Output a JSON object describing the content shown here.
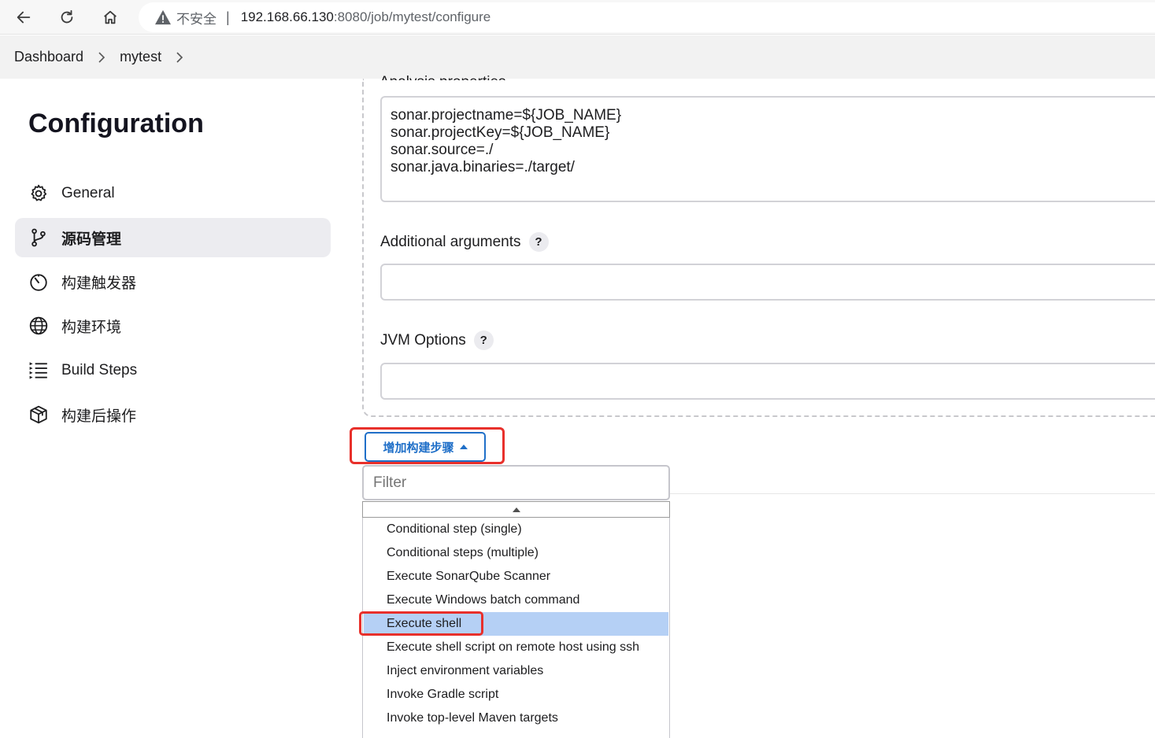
{
  "browser": {
    "insecure_label": "不安全",
    "url_host": "192.168.66.130",
    "url_path": ":8080/job/mytest/configure"
  },
  "breadcrumb": {
    "items": [
      "Dashboard",
      "mytest"
    ]
  },
  "sidebar": {
    "title": "Configuration",
    "items": [
      {
        "label": "General",
        "icon": "gear-icon"
      },
      {
        "label": "源码管理",
        "icon": "branch-icon",
        "active": true
      },
      {
        "label": "构建触发器",
        "icon": "timer-icon"
      },
      {
        "label": "构建环境",
        "icon": "globe-icon"
      },
      {
        "label": "Build Steps",
        "icon": "list-icon"
      },
      {
        "label": "构建后操作",
        "icon": "package-icon"
      }
    ]
  },
  "form": {
    "analysis_label": "Analysis properties",
    "analysis_value": "sonar.projectname=${JOB_NAME}\nsonar.projectKey=${JOB_NAME}\nsonar.source=./\nsonar.java.binaries=./target/",
    "additional_label": "Additional arguments",
    "jvm_label": "JVM Options",
    "help_glyph": "?"
  },
  "add_step": {
    "label": "增加构建步骤",
    "filter_placeholder": "Filter",
    "options": [
      "Conditional step (single)",
      "Conditional steps (multiple)",
      "Execute SonarQube Scanner",
      "Execute Windows batch command",
      "Execute shell",
      "Execute shell script on remote host using ssh",
      "Inject environment variables",
      "Invoke Gradle script",
      "Invoke top-level Maven targets"
    ],
    "highlighted": "Execute shell"
  },
  "colors": {
    "accent": "#1f6fc8",
    "highlight": "#b5d0f5",
    "annotation": "#e8302b"
  }
}
